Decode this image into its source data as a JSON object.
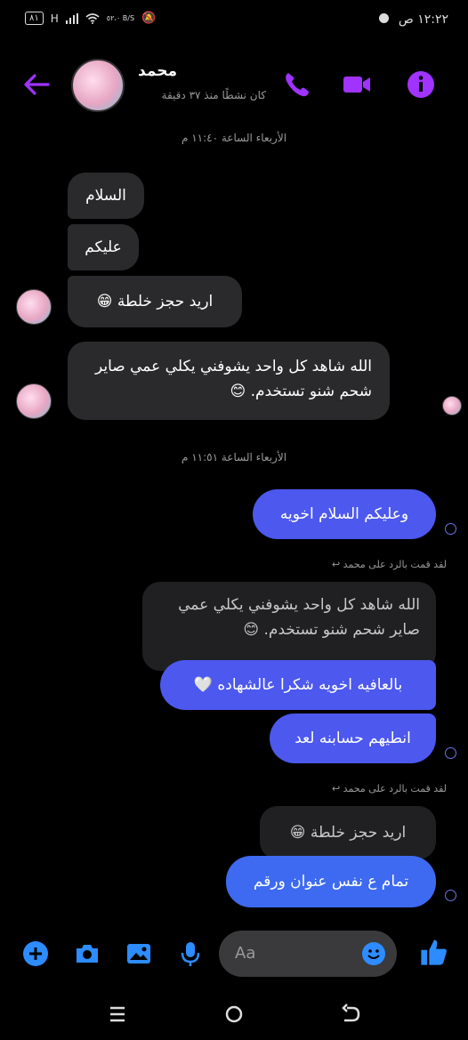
{
  "status_bar": {
    "time": "١٢:٢٢ ص",
    "battery": "٨١",
    "network": "H",
    "speed": "٥٢،٠ B/S"
  },
  "header": {
    "contact_name": "محمد",
    "active_status": "كان نشطًا منذ ٣٧ دقيقة"
  },
  "messages": {
    "timestamp_1": "الأربعاء الساعة ١١:٤٠ م",
    "in_1": "السلام",
    "in_2": "عليكم",
    "in_3": "اريد حجز خلطة 😁",
    "in_4": "الله شاهد كل واحد يشوفني يكلي عمي صاير شحم شنو تستخدم. 😊",
    "timestamp_2": "الأربعاء الساعة ١١:٥١ م",
    "out_1": "وعليكم السلام اخويه",
    "reply_note_1": "لقد قمت بالرد على محمد",
    "quoted_1": "الله شاهد كل واحد يشوفني يكلي عمي صاير شحم شنو تستخدم. 😊",
    "out_2": "بالعافيه اخويه شكرا عالشهاده 🤍",
    "out_3": "انطيهم حسابنه لعد",
    "reply_note_2": "لقد قمت بالرد على محمد",
    "quoted_2": "اريد حجز خلطة 😁",
    "out_4": "تمام ع نفس عنوان ورقم"
  },
  "composer": {
    "placeholder": "Aa"
  },
  "colors": {
    "accent": "#4c58ee",
    "icon_purple": "#a033ff",
    "icon_blue": "#2d8cff",
    "incoming_bubble": "#2a2a2c"
  }
}
